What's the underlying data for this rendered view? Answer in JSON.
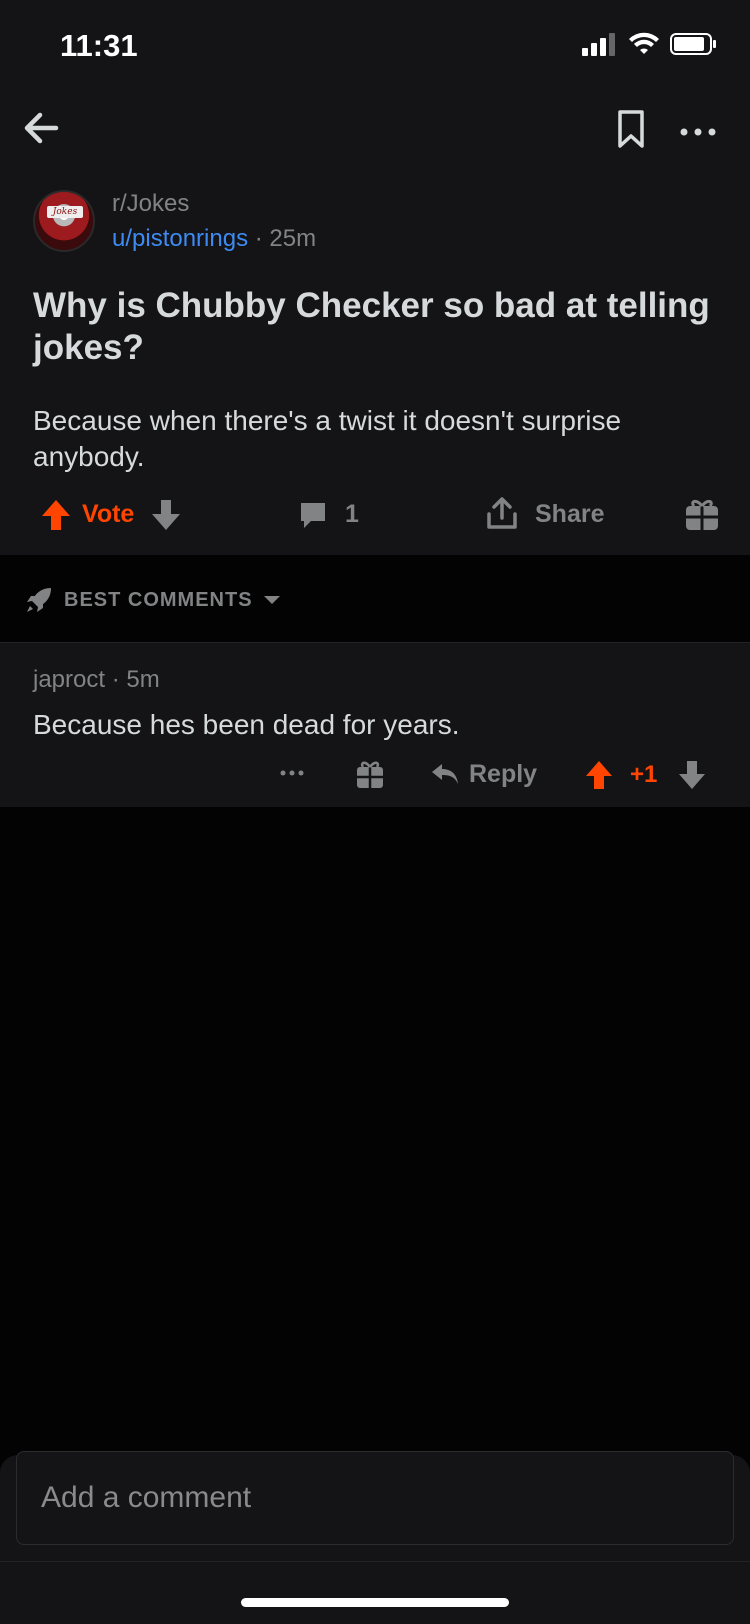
{
  "status_bar": {
    "time": "11:31"
  },
  "colors": {
    "upvote": "#ff4500",
    "link": "#3d8bf2",
    "muted": "#818384",
    "text": "#d7dadc",
    "bg": "#030303",
    "card": "#141416"
  },
  "nav": {
    "back_icon": "arrow-left-icon",
    "save_icon": "bookmark-icon",
    "more_icon": "more-horizontal-icon"
  },
  "post": {
    "subreddit": "r/Jokes",
    "author": "u/pistonrings",
    "separator": "·",
    "age": "25m",
    "title": "Why is Chubby Checker so bad at telling jokes?",
    "body": "Because when there's a twist it doesn't surprise anybody.",
    "vote_label": "Vote",
    "comment_count": "1",
    "share_label": "Share",
    "avatar_text": "Jokes"
  },
  "sort": {
    "label": "BEST COMMENTS"
  },
  "comments": [
    {
      "author": "japroct",
      "separator": "·",
      "age": "5m",
      "text": "Because hes been dead for years.",
      "reply_label": "Reply",
      "score": "+1"
    }
  ],
  "composer": {
    "placeholder": "Add a comment"
  }
}
